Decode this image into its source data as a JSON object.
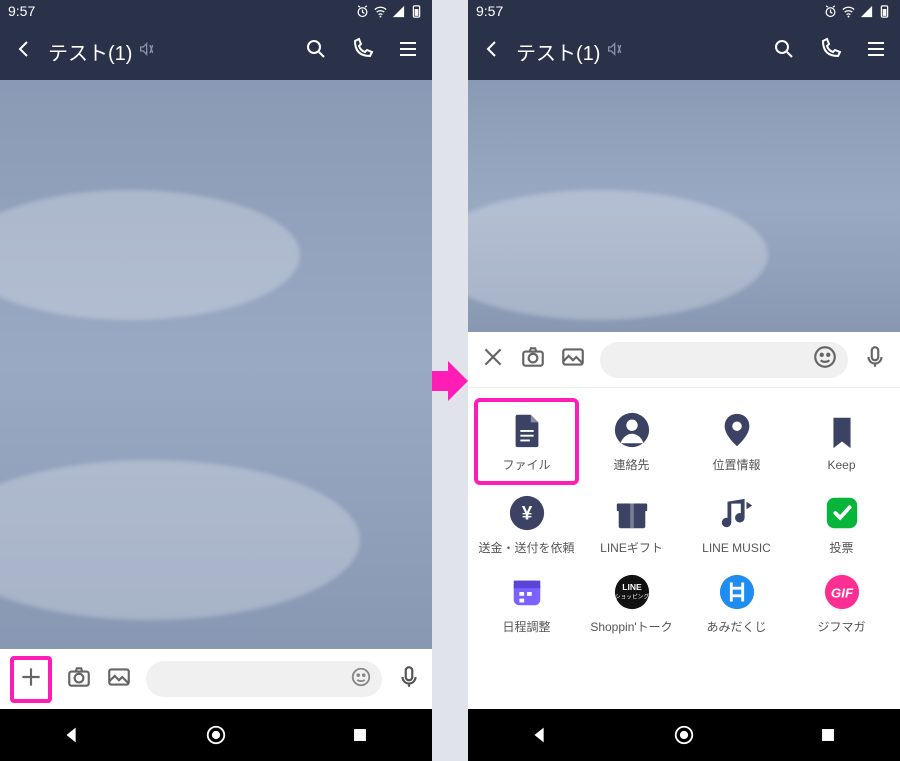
{
  "status": {
    "time": "9:57"
  },
  "chat": {
    "title": "テスト(1)"
  },
  "attachments": [
    {
      "id": "file",
      "label": "ファイル"
    },
    {
      "id": "contact",
      "label": "連絡先"
    },
    {
      "id": "location",
      "label": "位置情報"
    },
    {
      "id": "keep",
      "label": "Keep"
    },
    {
      "id": "transfer",
      "label": "送金・送付を依頼"
    },
    {
      "id": "gift",
      "label": "LINEギフト"
    },
    {
      "id": "music",
      "label": "LINE MUSIC"
    },
    {
      "id": "poll",
      "label": "投票"
    },
    {
      "id": "schedule",
      "label": "日程調整"
    },
    {
      "id": "shopping",
      "label": "Shoppin'トーク"
    },
    {
      "id": "amida",
      "label": "あみだくじ"
    },
    {
      "id": "gifmaga",
      "label": "ジフマガ"
    }
  ],
  "colors": {
    "highlight": "#ff1db5",
    "navy": "#3b4264",
    "green": "#07b53b",
    "blue": "#1f8cef",
    "magenta": "#ff2e93",
    "purple": "#7b61ff"
  }
}
